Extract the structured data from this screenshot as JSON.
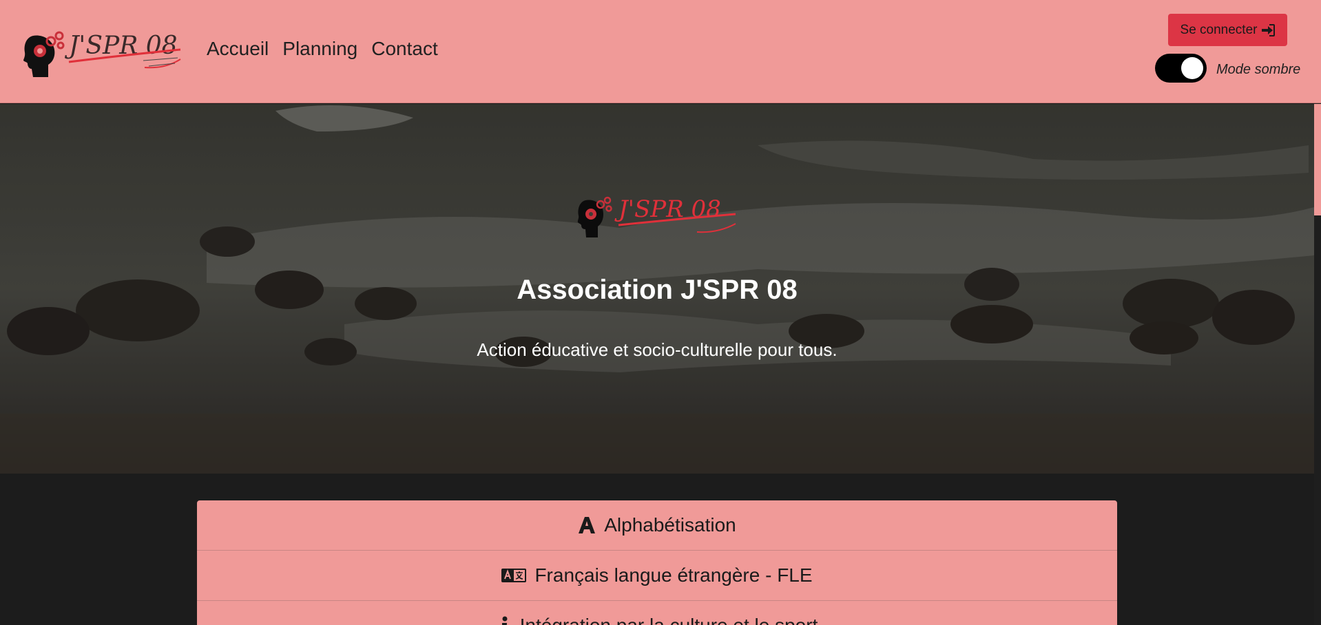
{
  "header": {
    "brand": "J'SPR 08",
    "nav": [
      {
        "label": "Accueil"
      },
      {
        "label": "Planning"
      },
      {
        "label": "Contact"
      }
    ],
    "login_label": "Se connecter",
    "dark_mode_label": "Mode sombre",
    "dark_mode_on": true
  },
  "hero": {
    "title": "Association J'SPR 08",
    "subtitle": "Action éducative et socio-culturelle pour tous."
  },
  "activities": [
    {
      "label": "Alphabétisation",
      "icon": "letter-a-icon"
    },
    {
      "label": "Français langue étrangère - FLE",
      "icon": "language-icon"
    },
    {
      "label": "Intégration par la culture et le sport",
      "icon": "person-icon"
    }
  ],
  "colors": {
    "accent": "#f09a98",
    "button": "#dc3545",
    "background": "#1c1c1c"
  }
}
